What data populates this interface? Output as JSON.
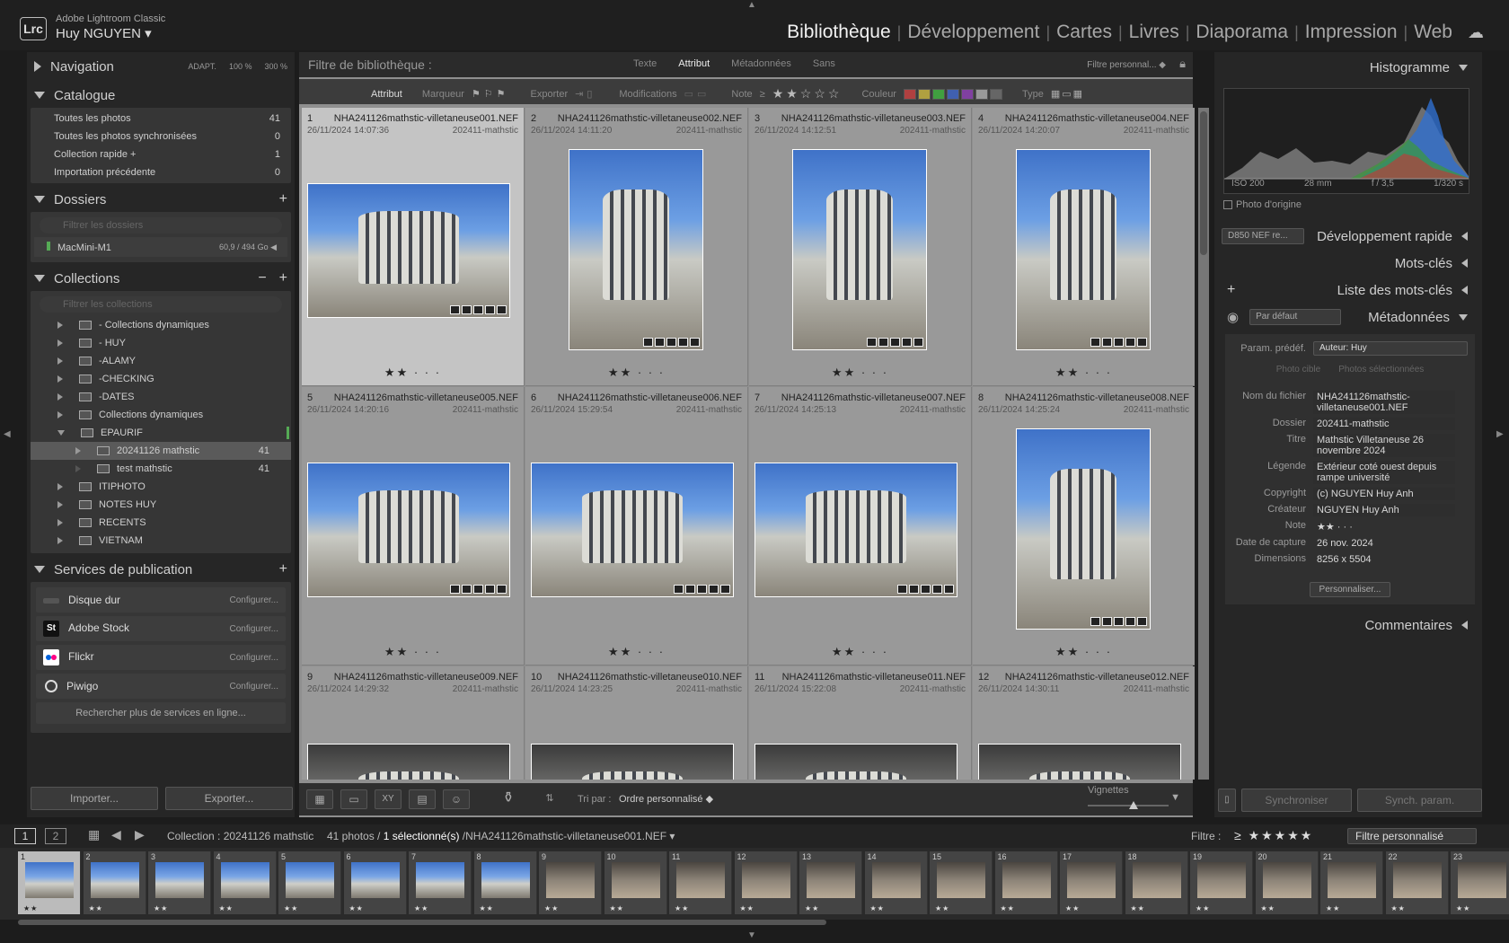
{
  "app": {
    "name": "Adobe Lightroom Classic",
    "logo": "Lrc",
    "user": "Huy NGUYEN ▾"
  },
  "modules": [
    "Bibliothèque",
    "Développement",
    "Cartes",
    "Livres",
    "Diaporama",
    "Impression",
    "Web"
  ],
  "left": {
    "navigation": {
      "title": "Navigation",
      "zoom": [
        "ADAPT.",
        "100 %",
        "300 %"
      ]
    },
    "catalogue": {
      "title": "Catalogue",
      "items": [
        {
          "label": "Toutes les photos",
          "count": "41"
        },
        {
          "label": "Toutes les photos synchronisées",
          "count": "0"
        },
        {
          "label": "Collection rapide +",
          "count": "1"
        },
        {
          "label": "Importation précédente",
          "count": "0"
        }
      ]
    },
    "dossiers": {
      "title": "Dossiers",
      "filter_placeholder": "Filtrer les dossiers",
      "volume": "MacMini-M1",
      "volume_size": "60,9 / 494 Go"
    },
    "collections": {
      "title": "Collections",
      "filter_placeholder": "Filtrer les collections",
      "items": [
        {
          "label": "- Collections dynamiques",
          "count": ""
        },
        {
          "label": "- HUY",
          "count": ""
        },
        {
          "label": "-ALAMY",
          "count": ""
        },
        {
          "label": "-CHECKING",
          "count": ""
        },
        {
          "label": "-DATES",
          "count": ""
        },
        {
          "label": "Collections dynamiques",
          "count": ""
        },
        {
          "label": "EPAURIF",
          "count": ""
        },
        {
          "label": "20241126 mathstic",
          "count": "41"
        },
        {
          "label": "test mathstic",
          "count": "41"
        },
        {
          "label": "ITIPHOTO",
          "count": ""
        },
        {
          "label": "NOTES HUY",
          "count": ""
        },
        {
          "label": "RECENTS",
          "count": ""
        },
        {
          "label": "VIETNAM",
          "count": ""
        }
      ]
    },
    "services": {
      "title": "Services de publication",
      "configure": "Configurer...",
      "items": [
        "Disque dur",
        "Adobe Stock",
        "Flickr",
        "Piwigo"
      ],
      "more": "Rechercher plus de services en ligne..."
    },
    "import_btn": "Importer...",
    "export_btn": "Exporter..."
  },
  "filter_bar": {
    "title": "Filtre de bibliothèque :",
    "tabs": [
      "Texte",
      "Attribut",
      "Métadonnées",
      "Sans"
    ],
    "preset": "Filtre personnal... ◆",
    "attr": {
      "label": "Attribut",
      "marqueur": "Marqueur",
      "exporter": "Exporter",
      "modifications": "Modifications",
      "note": "Note",
      "note_op": "≥",
      "couleur": "Couleur",
      "type": "Type"
    }
  },
  "grid": [
    {
      "n": "1",
      "file": "NHA241126mathstic-villetaneuse001.NEF",
      "date": "26/11/2024 14:07:36",
      "folder": "202411-mathstic",
      "stars": "★★ · · ·"
    },
    {
      "n": "2",
      "file": "NHA241126mathstic-villetaneuse002.NEF",
      "date": "26/11/2024 14:11:20",
      "folder": "202411-mathstic",
      "stars": "★★ · · ·"
    },
    {
      "n": "3",
      "file": "NHA241126mathstic-villetaneuse003.NEF",
      "date": "26/11/2024 14:12:51",
      "folder": "202411-mathstic",
      "stars": "★★ · · ·"
    },
    {
      "n": "4",
      "file": "NHA241126mathstic-villetaneuse004.NEF",
      "date": "26/11/2024 14:20:07",
      "folder": "202411-mathstic",
      "stars": "★★ · · ·"
    },
    {
      "n": "5",
      "file": "NHA241126mathstic-villetaneuse005.NEF",
      "date": "26/11/2024 14:20:16",
      "folder": "202411-mathstic",
      "stars": "★★ · · ·"
    },
    {
      "n": "6",
      "file": "NHA241126mathstic-villetaneuse006.NEF",
      "date": "26/11/2024 15:29:54",
      "folder": "202411-mathstic",
      "stars": "★★ · · ·"
    },
    {
      "n": "7",
      "file": "NHA241126mathstic-villetaneuse007.NEF",
      "date": "26/11/2024 14:25:13",
      "folder": "202411-mathstic",
      "stars": "★★ · · ·"
    },
    {
      "n": "8",
      "file": "NHA241126mathstic-villetaneuse008.NEF",
      "date": "26/11/2024 14:25:24",
      "folder": "202411-mathstic",
      "stars": "★★ · · ·"
    },
    {
      "n": "9",
      "file": "NHA241126mathstic-villetaneuse009.NEF",
      "date": "26/11/2024 14:29:32",
      "folder": "202411-mathstic",
      "stars": ""
    },
    {
      "n": "10",
      "file": "NHA241126mathstic-villetaneuse010.NEF",
      "date": "26/11/2024 14:23:25",
      "folder": "202411-mathstic",
      "stars": ""
    },
    {
      "n": "11",
      "file": "NHA241126mathstic-villetaneuse011.NEF",
      "date": "26/11/2024 15:22:08",
      "folder": "202411-mathstic",
      "stars": ""
    },
    {
      "n": "12",
      "file": "NHA241126mathstic-villetaneuse012.NEF",
      "date": "26/11/2024 14:30:11",
      "folder": "202411-mathstic",
      "stars": ""
    }
  ],
  "toolbar": {
    "sort_label": "Tri par :",
    "sort_value": "Ordre personnalisé ◆",
    "vignettes": "Vignettes"
  },
  "right": {
    "histogramme": "Histogramme",
    "exif": {
      "iso": "ISO 200",
      "focal": "28 mm",
      "aperture": "f / 3,5",
      "shutter": "1/320 s"
    },
    "photo_origine": "Photo d'origine",
    "quick_dev_preset": "D850 NEF re...",
    "quick_dev": "Développement rapide",
    "mots_cles": "Mots-clés",
    "liste_mots_cles": "Liste des mots-clés",
    "meta_preset": "Par défaut",
    "metadonnees": "Métadonnées",
    "param_label": "Param. prédéf.",
    "param_value": "Auteur: Huy",
    "target": "Photo cible",
    "selected": "Photos sélectionnées",
    "fields": [
      {
        "k": "Nom du fichier",
        "v": "NHA241126mathstic-villetaneuse001.NEF"
      },
      {
        "k": "Dossier",
        "v": "202411-mathstic"
      },
      {
        "k": "Titre",
        "v": "Mathstic Villetaneuse 26 novembre 2024"
      },
      {
        "k": "Légende",
        "v": "Extérieur coté ouest depuis rampe université"
      },
      {
        "k": "Copyright",
        "v": "(c) NGUYEN Huy Anh"
      },
      {
        "k": "Créateur",
        "v": "NGUYEN Huy Anh"
      },
      {
        "k": "Note",
        "v": "★★ · · ·"
      },
      {
        "k": "Date de capture",
        "v": "26 nov. 2024"
      },
      {
        "k": "Dimensions",
        "v": "8256 x 5504"
      }
    ],
    "personnaliser": "Personnaliser...",
    "commentaires": "Commentaires",
    "sync": "Synchroniser",
    "sync_param": "Synch. param."
  },
  "filmstrip_bar": {
    "screen1": "1",
    "screen2": "2",
    "collection": "Collection : 20241126 mathstic",
    "count": "41 photos /",
    "selected": "1 sélectionné(s)",
    "file": "/NHA241126mathstic-villetaneuse001.NEF ▾",
    "filtre": "Filtre :",
    "filtre_stars": "≥ ★★★★★",
    "filtre_preset": "Filtre personnalisé"
  },
  "filmstrip": [
    "1",
    "2",
    "3",
    "4",
    "5",
    "6",
    "7",
    "8",
    "9",
    "10",
    "11",
    "12",
    "13",
    "14",
    "15",
    "16",
    "17",
    "18",
    "19",
    "20",
    "21",
    "22",
    "23"
  ]
}
